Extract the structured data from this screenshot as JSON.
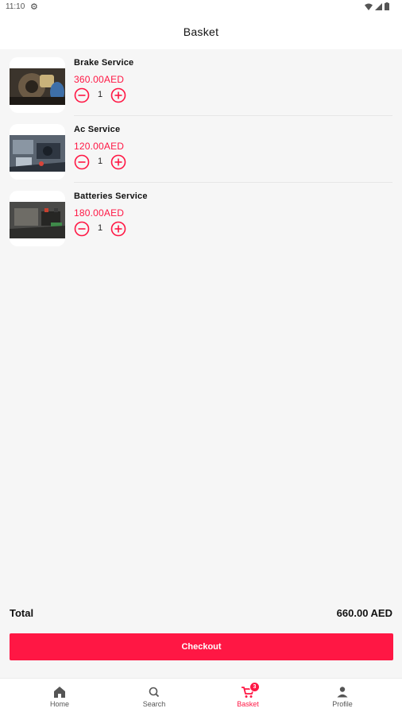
{
  "status_bar": {
    "time": "11:10"
  },
  "header": {
    "title": "Basket"
  },
  "items": [
    {
      "name": "Brake Service",
      "price": "360.00AED",
      "qty": "1"
    },
    {
      "name": "Ac Service",
      "price": "120.00AED",
      "qty": "1"
    },
    {
      "name": "Batteries Service",
      "price": "180.00AED",
      "qty": "1"
    }
  ],
  "summary": {
    "total_label": "Total",
    "total_value": "660.00 AED"
  },
  "checkout": {
    "label": "Checkout"
  },
  "nav": {
    "items": [
      {
        "label": "Home",
        "icon": "home-icon"
      },
      {
        "label": "Search",
        "icon": "search-icon"
      },
      {
        "label": "Basket",
        "icon": "cart-icon",
        "badge": "3"
      },
      {
        "label": "Profile",
        "icon": "person-icon"
      }
    ],
    "active": "Basket"
  },
  "colors": {
    "accent": "#ff1744",
    "background": "#f6f6f6"
  }
}
